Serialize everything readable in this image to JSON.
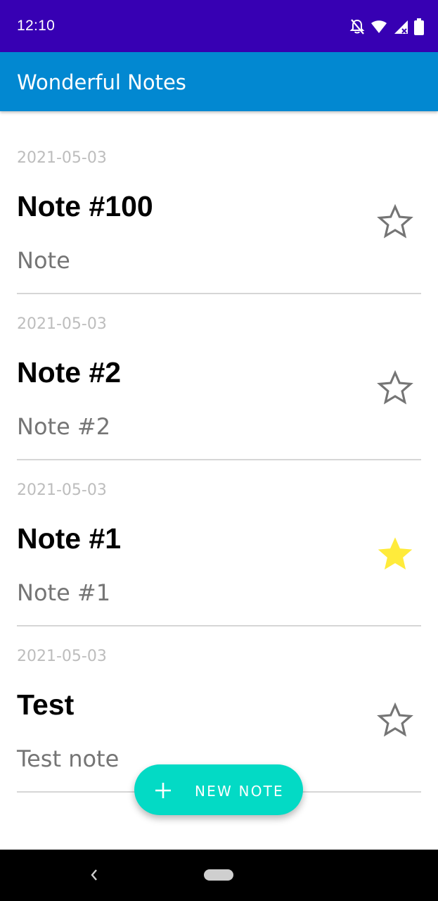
{
  "status_bar": {
    "time": "12:10",
    "icons": [
      "notifications-off-icon",
      "wifi-icon",
      "signal-icon",
      "battery-icon"
    ]
  },
  "app_bar": {
    "title": "Wonderful Notes",
    "color": "#0288d1"
  },
  "notes": [
    {
      "date": "2021-05-03",
      "title": "Note #100",
      "body": "Note",
      "starred": false
    },
    {
      "date": "2021-05-03",
      "title": "Note #2",
      "body": "Note #2",
      "starred": false
    },
    {
      "date": "2021-05-03",
      "title": "Note #1",
      "body": "Note #1",
      "starred": true
    },
    {
      "date": "2021-05-03",
      "title": "Test",
      "body": "Test note",
      "starred": false
    }
  ],
  "fab": {
    "label": "NEW NOTE",
    "icon": "plus-icon",
    "color": "#03dac5"
  },
  "colors": {
    "status_bar": "#3700b3",
    "star_filled": "#ffeb3b",
    "star_outline": "#757575"
  },
  "nav_bar": {
    "icons": [
      "back-icon",
      "home-pill-icon"
    ]
  }
}
